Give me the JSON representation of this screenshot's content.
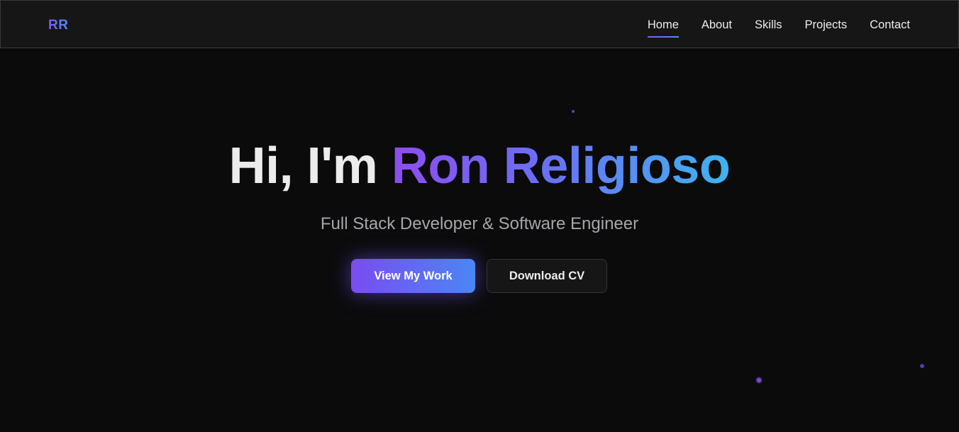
{
  "navbar": {
    "logo": "RR",
    "links": [
      {
        "label": "Home",
        "active": true
      },
      {
        "label": "About",
        "active": false
      },
      {
        "label": "Skills",
        "active": false
      },
      {
        "label": "Projects",
        "active": false
      },
      {
        "label": "Contact",
        "active": false
      }
    ]
  },
  "hero": {
    "greeting": "Hi, I'm ",
    "name": "Ron Religioso",
    "subtitle": "Full Stack Developer & Software Engineer",
    "primary_button": "View My Work",
    "secondary_button": "Download CV"
  },
  "colors": {
    "background": "#0b0b0c",
    "navbar_bg": "#161617",
    "accent_purple": "#7a4cf0",
    "accent_blue": "#4b86f6",
    "accent_cyan": "#3eb4f0"
  }
}
